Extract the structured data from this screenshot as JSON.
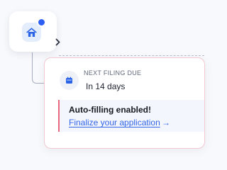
{
  "home": {
    "icon": "home-icon",
    "has_notification": true,
    "notification_color": "#2d5ff5",
    "expand_icon": "chevron-right-icon"
  },
  "filing": {
    "label": "NEXT FILING DUE",
    "value": "In 14 days",
    "icon": "calendar-icon"
  },
  "alert": {
    "title": "Auto-filling enabled!",
    "link_text": "Finalize your application",
    "link_arrow": "→",
    "accent_color": "#e9687f",
    "link_color": "#3264e8"
  }
}
